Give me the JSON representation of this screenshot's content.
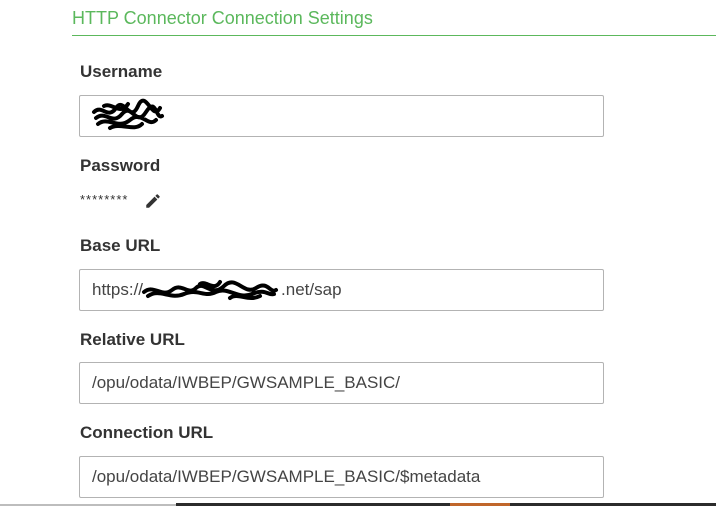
{
  "section": {
    "title": "HTTP Connector Connection Settings"
  },
  "fields": {
    "username": {
      "label": "Username",
      "value": ""
    },
    "password": {
      "label": "Password",
      "masked_value": "********",
      "edit_icon": "pencil-icon"
    },
    "base_url": {
      "label": "Base URL",
      "value_prefix": "https://",
      "value_suffix": ".net/sap"
    },
    "relative_url": {
      "label": "Relative URL",
      "value": "/opu/odata/IWBEP/GWSAMPLE_BASIC/"
    },
    "connection_url": {
      "label": "Connection URL",
      "value": "/opu/odata/IWBEP/GWSAMPLE_BASIC/$metadata"
    }
  },
  "colors": {
    "accent_green": "#5bb85c",
    "label_text": "#333333",
    "input_border": "#b3b3b3"
  }
}
